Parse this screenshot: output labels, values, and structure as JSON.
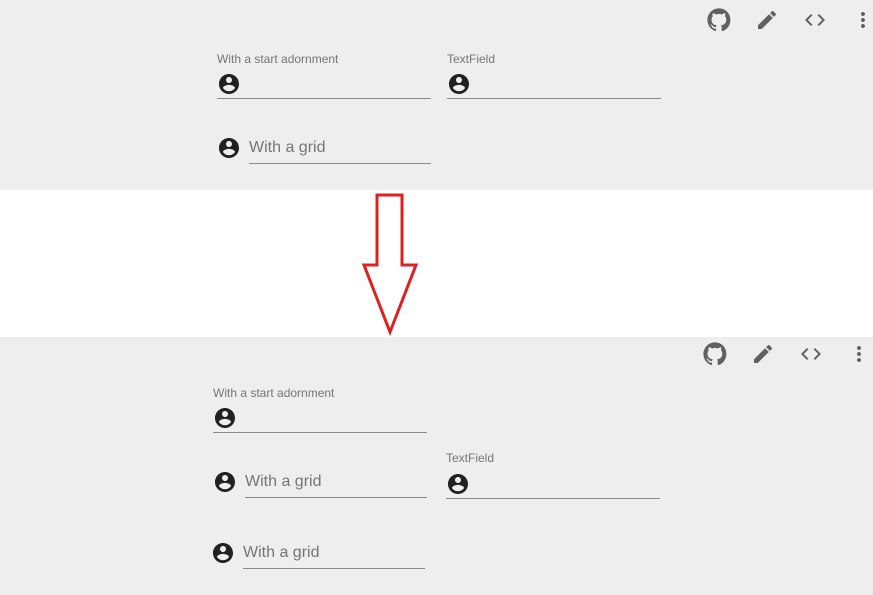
{
  "colors": {
    "panel_background": "#eeeeee",
    "gap_background": "#ffffff",
    "icon": "#212121",
    "toolbar_icon": "#616161",
    "label": "#757575",
    "underline": "#8a8a8a",
    "arrow": "#e02020"
  },
  "icons": {
    "adornment": "account-circle-icon",
    "toolbar": [
      "github-icon",
      "edit-pencil-icon",
      "code-icon",
      "more-vertical-icon"
    ]
  },
  "before": {
    "fields": {
      "start_adornment": {
        "label": "With a start adornment"
      },
      "textfield": {
        "label": "TextField"
      },
      "grid": {
        "placeholder": "With a grid"
      }
    }
  },
  "after": {
    "fields": {
      "start_adornment": {
        "label": "With a start adornment"
      },
      "textfield": {
        "label": "TextField"
      },
      "grid_1": {
        "placeholder": "With a grid"
      },
      "grid_2": {
        "placeholder": "With a grid"
      }
    }
  }
}
